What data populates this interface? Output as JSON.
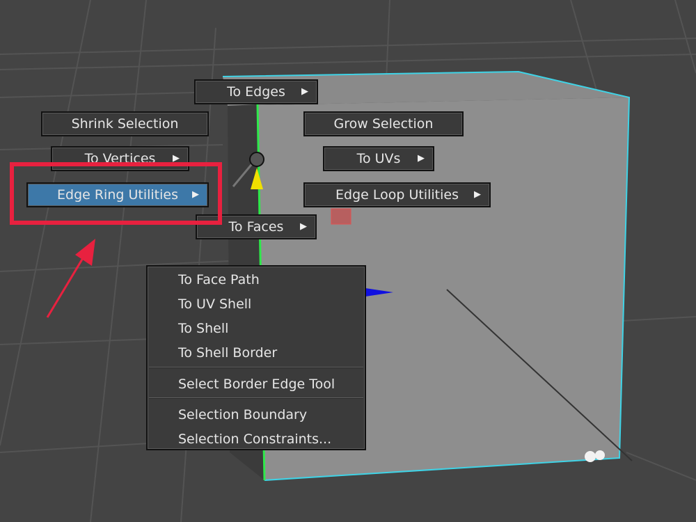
{
  "marking_menu": {
    "north": {
      "label": "To Edges"
    },
    "northwest": {
      "label": "Shrink Selection"
    },
    "northeast": {
      "label": "Grow Selection"
    },
    "west_upper": {
      "label": "To Vertices"
    },
    "east_upper": {
      "label": "To UVs"
    },
    "west": {
      "label": "Edge Ring Utilities",
      "highlighted": true
    },
    "east": {
      "label": "Edge Loop Utilities"
    },
    "south": {
      "label": "To Faces"
    },
    "submenu_icon": "triangle-right-icon"
  },
  "context_menu": {
    "items": [
      {
        "label": "To Face Path"
      },
      {
        "label": "To UV Shell"
      },
      {
        "label": "To Shell"
      },
      {
        "label": "To Shell Border"
      },
      {
        "label": "Select Border Edge Tool"
      },
      {
        "label": "Selection Boundary"
      },
      {
        "label": "Selection Constraints..."
      }
    ]
  },
  "annotation": {
    "highlight_color": "#e8213f",
    "pointer": "red-arrow-icon"
  },
  "colors": {
    "viewport_bg": "#444444",
    "cube_face": "#8e8e8e",
    "cube_edge": "#3fd3e6",
    "highlight_button": "#3d78a8",
    "manip_yellow": "#f0e000",
    "manip_blue": "#1010e0"
  }
}
